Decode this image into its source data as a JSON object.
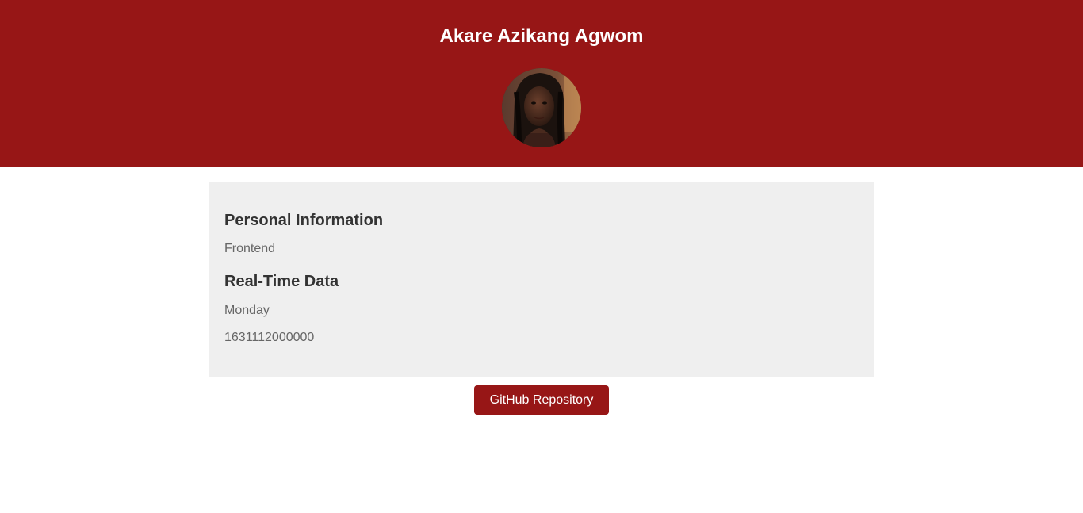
{
  "header": {
    "name": "Akare Azikang Agwom"
  },
  "personal_info": {
    "heading": "Personal Information",
    "track": "Frontend"
  },
  "realtime": {
    "heading": "Real-Time Data",
    "day": "Monday",
    "timestamp": "1631112000000"
  },
  "actions": {
    "github_label": "GitHub Repository"
  },
  "colors": {
    "brand": "#971616",
    "card_bg": "#efefef",
    "heading_text": "#333333",
    "body_text": "#666666"
  }
}
